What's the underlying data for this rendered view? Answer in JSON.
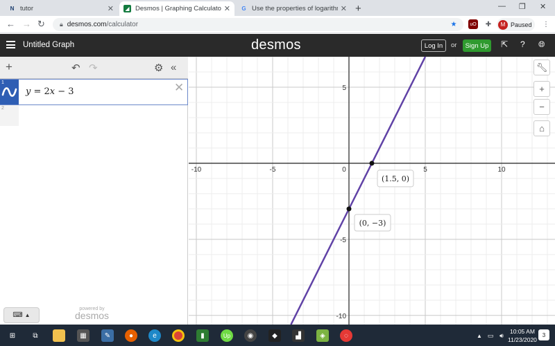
{
  "browser": {
    "tabs": [
      {
        "favicon": "N",
        "title": "tutor",
        "active": false
      },
      {
        "favicon": "desmos",
        "title": "Desmos | Graphing Calculator",
        "active": true
      },
      {
        "favicon": "G",
        "title": "Use the properties of logarithms",
        "active": false
      }
    ],
    "new_tab_label": "+",
    "url_domain": "desmos.com",
    "url_path": "/calculator",
    "profile_initial": "M",
    "profile_status": "Paused"
  },
  "desmos": {
    "graph_title": "Untitled Graph",
    "logo": "desmos",
    "login_label": "Log In",
    "or_label": "or",
    "signup_label": "Sign Up",
    "powered_by": "powered by",
    "powered_logo": "desmos",
    "expressions": [
      {
        "index": "1",
        "var": "y",
        "eq": " = 2",
        "var2": "x",
        "rest": " − 3",
        "color": "#2d70b3"
      }
    ],
    "empty_row_index": "2"
  },
  "graph": {
    "x_ticks": [
      "-10",
      "-5",
      "0",
      "5",
      "10"
    ],
    "y_ticks": [
      "5",
      "-5",
      "-10"
    ],
    "line_color": "#6042a6",
    "points": [
      {
        "x": 1.5,
        "y": 0,
        "label": "(1.5, 0)"
      },
      {
        "x": 0,
        "y": -3,
        "label": "(0, −3)"
      }
    ]
  },
  "chart_data": {
    "type": "line",
    "title": "",
    "xlabel": "",
    "ylabel": "",
    "xlim": [
      -10.5,
      13.5
    ],
    "ylim": [
      -10.6,
      7
    ],
    "grid": true,
    "series": [
      {
        "name": "y = 2x − 3",
        "x": [
          -3.5,
          3.5
        ],
        "y": [
          -10,
          4
        ],
        "slope": 2,
        "intercept": -3
      }
    ],
    "labeled_points": [
      {
        "x": 1.5,
        "y": 0,
        "label": "(1.5, 0)"
      },
      {
        "x": 0,
        "y": -3,
        "label": "(0, −3)"
      }
    ]
  },
  "taskbar": {
    "time": "10:05 AM",
    "date": "11/23/2020",
    "notif_count": "3"
  }
}
